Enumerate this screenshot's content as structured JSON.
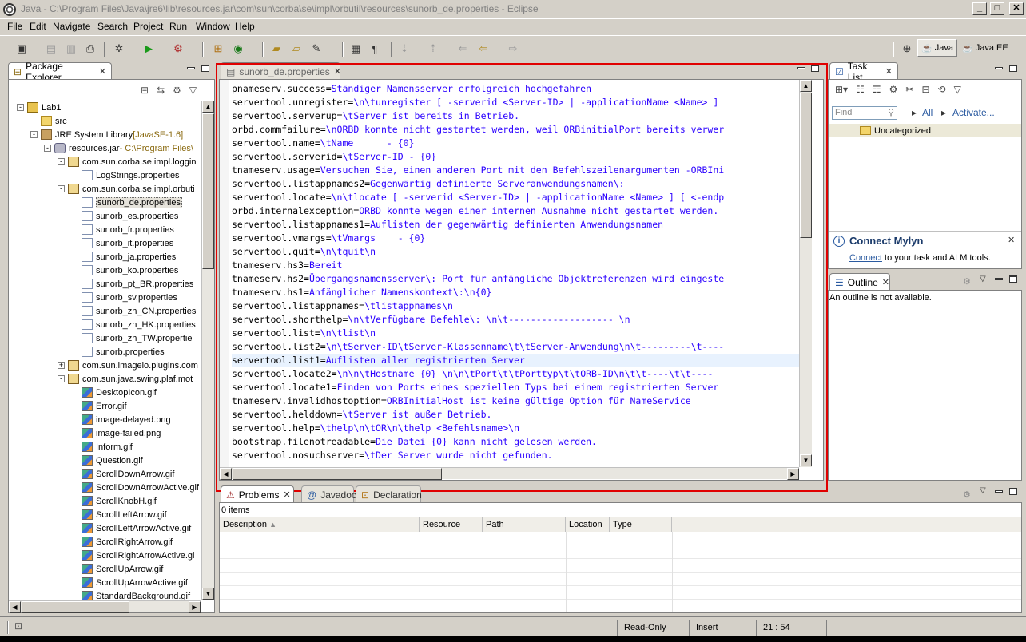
{
  "window": {
    "title": "Java - C:\\Program Files\\Java\\jre6\\lib\\resources.jar\\com\\sun\\corba\\se\\impl\\orbutil\\resources\\sunorb_de.properties - Eclipse",
    "min_glyph": "_",
    "max_glyph": "□",
    "close_glyph": "✕"
  },
  "menu": [
    "File",
    "Edit",
    "Navigate",
    "Search",
    "Project",
    "Run",
    "Window",
    "Help"
  ],
  "perspectives": [
    {
      "label": "Java",
      "active": true
    },
    {
      "label": "Java EE",
      "active": false
    }
  ],
  "package_explorer": {
    "title": "Package Explorer",
    "tree": [
      {
        "label": "Lab1",
        "icon": "project-icon",
        "indent": 0,
        "expander": "-"
      },
      {
        "label": "src",
        "icon": "folder-icon",
        "indent": 1,
        "expander": ""
      },
      {
        "label": "JRE System Library",
        "suffix": " [JavaSE-1.6]",
        "icon": "library-icon",
        "indent": 1,
        "expander": "-"
      },
      {
        "label": "resources.jar",
        "suffix": " - C:\\Program Files\\",
        "icon": "jar-icon",
        "indent": 2,
        "expander": "-"
      },
      {
        "label": "com.sun.corba.se.impl.loggin",
        "icon": "package-icon",
        "indent": 3,
        "expander": "-"
      },
      {
        "label": "LogStrings.properties",
        "icon": "file-icon",
        "indent": 4,
        "expander": ""
      },
      {
        "label": "com.sun.corba.se.impl.orbuti",
        "icon": "package-icon",
        "indent": 3,
        "expander": "-"
      },
      {
        "label": "sunorb_de.properties",
        "icon": "file-icon",
        "indent": 4,
        "expander": "",
        "selected": true
      },
      {
        "label": "sunorb_es.properties",
        "icon": "file-icon",
        "indent": 4,
        "expander": ""
      },
      {
        "label": "sunorb_fr.properties",
        "icon": "file-icon",
        "indent": 4,
        "expander": ""
      },
      {
        "label": "sunorb_it.properties",
        "icon": "file-icon",
        "indent": 4,
        "expander": ""
      },
      {
        "label": "sunorb_ja.properties",
        "icon": "file-icon",
        "indent": 4,
        "expander": ""
      },
      {
        "label": "sunorb_ko.properties",
        "icon": "file-icon",
        "indent": 4,
        "expander": ""
      },
      {
        "label": "sunorb_pt_BR.properties",
        "icon": "file-icon",
        "indent": 4,
        "expander": ""
      },
      {
        "label": "sunorb_sv.properties",
        "icon": "file-icon",
        "indent": 4,
        "expander": ""
      },
      {
        "label": "sunorb_zh_CN.properties",
        "icon": "file-icon",
        "indent": 4,
        "expander": ""
      },
      {
        "label": "sunorb_zh_HK.properties",
        "icon": "file-icon",
        "indent": 4,
        "expander": ""
      },
      {
        "label": "sunorb_zh_TW.propertie",
        "icon": "file-icon",
        "indent": 4,
        "expander": ""
      },
      {
        "label": "sunorb.properties",
        "icon": "file-icon",
        "indent": 4,
        "expander": ""
      },
      {
        "label": "com.sun.imageio.plugins.com",
        "icon": "package-icon",
        "indent": 3,
        "expander": "+"
      },
      {
        "label": "com.sun.java.swing.plaf.mot",
        "icon": "package-icon",
        "indent": 3,
        "expander": "-"
      },
      {
        "label": "DesktopIcon.gif",
        "icon": "image-icon",
        "indent": 4,
        "expander": ""
      },
      {
        "label": "Error.gif",
        "icon": "image-icon",
        "indent": 4,
        "expander": ""
      },
      {
        "label": "image-delayed.png",
        "icon": "image-icon",
        "indent": 4,
        "expander": ""
      },
      {
        "label": "image-failed.png",
        "icon": "image-icon",
        "indent": 4,
        "expander": ""
      },
      {
        "label": "Inform.gif",
        "icon": "image-icon",
        "indent": 4,
        "expander": ""
      },
      {
        "label": "Question.gif",
        "icon": "image-icon",
        "indent": 4,
        "expander": ""
      },
      {
        "label": "ScrollDownArrow.gif",
        "icon": "image-icon",
        "indent": 4,
        "expander": ""
      },
      {
        "label": "ScrollDownArrowActive.gif",
        "icon": "image-icon",
        "indent": 4,
        "expander": ""
      },
      {
        "label": "ScrollKnobH.gif",
        "icon": "image-icon",
        "indent": 4,
        "expander": ""
      },
      {
        "label": "ScrollLeftArrow.gif",
        "icon": "image-icon",
        "indent": 4,
        "expander": ""
      },
      {
        "label": "ScrollLeftArrowActive.gif",
        "icon": "image-icon",
        "indent": 4,
        "expander": ""
      },
      {
        "label": "ScrollRightArrow.gif",
        "icon": "image-icon",
        "indent": 4,
        "expander": ""
      },
      {
        "label": "ScrollRightArrowActive.gi",
        "icon": "image-icon",
        "indent": 4,
        "expander": ""
      },
      {
        "label": "ScrollUpArrow.gif",
        "icon": "image-icon",
        "indent": 4,
        "expander": ""
      },
      {
        "label": "ScrollUpArrowActive.gif",
        "icon": "image-icon",
        "indent": 4,
        "expander": ""
      },
      {
        "label": "StandardBackground.gif",
        "icon": "image-icon",
        "indent": 4,
        "expander": ""
      }
    ]
  },
  "editor": {
    "tab_label": "sunorb_de.properties",
    "lines": [
      {
        "k": "pnameserv.success=",
        "v": "Ständiger Namensserver erfolgreich hochgefahren"
      },
      {
        "k": "servertool.unregister=",
        "v": "\\n\\tunregister [ -serverid <Server-ID> | -applicationName <Name> ]"
      },
      {
        "k": "servertool.serverup=",
        "v": "\\tServer ist bereits in Betrieb."
      },
      {
        "k": "orbd.commfailure=",
        "v": "\\nORBD konnte nicht gestartet werden, weil ORBinitialPort bereits verwer"
      },
      {
        "k": "servertool.name=",
        "v": "\\tName      - {0}"
      },
      {
        "k": "servertool.serverid=",
        "v": "\\tServer-ID - {0}"
      },
      {
        "k": "tnameserv.usage=",
        "v": "Versuchen Sie, einen anderen Port mit den Befehlszeilenargumenten -ORBIni"
      },
      {
        "k": "servertool.listappnames2=",
        "v": "Gegenwärtig definierte Serveranwendungsnamen\\:"
      },
      {
        "k": "servertool.locate=",
        "v": "\\n\\tlocate [ -serverid <Server-ID> | -applicationName <Name> ] [ <-endp"
      },
      {
        "k": "orbd.internalexception=",
        "v": "ORBD konnte wegen einer internen Ausnahme nicht gestartet werden."
      },
      {
        "k": "servertool.listappnames1=",
        "v": "Auflisten der gegenwärtig definierten Anwendungsnamen"
      },
      {
        "k": "servertool.vmargs=",
        "v": "\\tVmargs    - {0}"
      },
      {
        "k": "servertool.quit=",
        "v": "\\n\\tquit\\n"
      },
      {
        "k": "tnameserv.hs3=",
        "v": "Bereit"
      },
      {
        "k": "tnameserv.hs2=",
        "v": "Übergangsnamensserver\\: Port für anfängliche Objektreferenzen wird eingeste"
      },
      {
        "k": "tnameserv.hs1=",
        "v": "Anfänglicher Namenskontext\\:\\n{0}"
      },
      {
        "k": "servertool.listappnames=",
        "v": "\\tlistappnames\\n"
      },
      {
        "k": "servertool.shorthelp=",
        "v": "\\n\\tVerfügbare Befehle\\: \\n\\t------------------- \\n"
      },
      {
        "k": "servertool.list=",
        "v": "\\n\\tlist\\n"
      },
      {
        "k": "servertool.list2=",
        "v": "\\n\\tServer-ID\\tServer-Klassenname\\t\\tServer-Anwendung\\n\\t---------\\t----"
      },
      {
        "k": "servertool.list1=",
        "v": "Auflisten aller registrierten Server",
        "hl": true
      },
      {
        "k": "servertool.locate2=",
        "v": "\\n\\n\\tHostname {0} \\n\\n\\tPort\\t\\tPorttyp\\t\\tORB-ID\\n\\t\\t----\\t\\t----"
      },
      {
        "k": "servertool.locate1=",
        "v": "Finden von Ports eines speziellen Typs bei einem registrierten Server"
      },
      {
        "k": "tnameserv.invalidhostoption=",
        "v": "ORBInitialHost ist keine gültige Option für NameService"
      },
      {
        "k": "servertool.helddown=",
        "v": "\\tServer ist außer Betrieb."
      },
      {
        "k": "servertool.help=",
        "v": "\\thelp\\n\\tOR\\n\\thelp <Befehlsname>\\n"
      },
      {
        "k": "bootstrap.filenotreadable=",
        "v": "Die Datei {0} kann nicht gelesen werden."
      },
      {
        "k": "servertool.nosuchserver=",
        "v": "\\tDer Server wurde nicht gefunden."
      }
    ]
  },
  "task_list": {
    "title": "Task List",
    "find_placeholder": "Find",
    "all_label": "All",
    "activate_label": "Activate...",
    "category": "Uncategorized"
  },
  "mylyn": {
    "title": "Connect Mylyn",
    "link": "Connect",
    "text": " to your task and ALM tools."
  },
  "outline": {
    "title": "Outline",
    "message": "An outline is not available."
  },
  "bottom_panel": {
    "tabs": [
      "Problems",
      "Javadoc",
      "Declaration"
    ],
    "count": "0 items",
    "columns": [
      "Description",
      "Resource",
      "Path",
      "Location",
      "Type"
    ]
  },
  "status": {
    "mode": "Read-Only",
    "insert": "Insert",
    "position": "21 : 54"
  },
  "colors": {
    "highlight_frame": "#e00000",
    "string_value": "#2a00ff",
    "current_line": "#e8f2fe"
  }
}
